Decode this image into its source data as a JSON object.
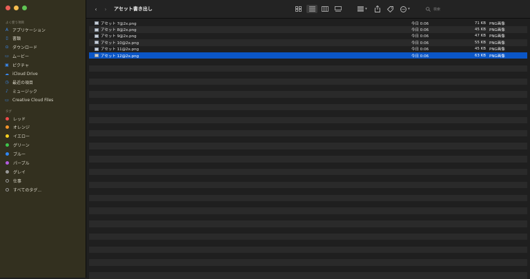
{
  "window": {
    "title": "アセット書き出し",
    "traffic_colors": [
      "#ec5f57",
      "#f5bd4f",
      "#60c554"
    ]
  },
  "toolbar": {
    "back_icon": "chevron-left-icon",
    "forward_icon": "chevron-right-icon",
    "view_icons": [
      "grid-view-icon",
      "list-view-icon",
      "column-view-icon",
      "gallery-view-icon"
    ],
    "search_placeholder": "検索"
  },
  "sidebar": {
    "favorites_label": "よく使う項目",
    "favorites": [
      {
        "label": "アプリケーション",
        "icon": "A"
      },
      {
        "label": "書類",
        "icon": "▯"
      },
      {
        "label": "ダウンロード",
        "icon": "⊙"
      },
      {
        "label": "ムービー",
        "icon": "▭"
      },
      {
        "label": "ピクチャ",
        "icon": "▣"
      },
      {
        "label": "iCloud Drive",
        "icon": "☁"
      },
      {
        "label": "最近の項目",
        "icon": "◷"
      },
      {
        "label": "ミュージック",
        "icon": "♪"
      },
      {
        "label": "Creative Cloud Files",
        "icon": "▭"
      }
    ],
    "tags_label": "タグ",
    "tags": [
      {
        "label": "レッド",
        "color": "#ef4b4b"
      },
      {
        "label": "オレンジ",
        "color": "#f5952a"
      },
      {
        "label": "イエロー",
        "color": "#f5d020"
      },
      {
        "label": "グリーン",
        "color": "#3ec44b"
      },
      {
        "label": "ブルー",
        "color": "#2f86f2"
      },
      {
        "label": "パープル",
        "color": "#b35cdf"
      },
      {
        "label": "グレイ",
        "color": "#9a9a9a"
      },
      {
        "label": "仕事",
        "color": "outline"
      },
      {
        "label": "すべてのタグ...",
        "color": "outline"
      }
    ]
  },
  "files": [
    {
      "name": "アセット 7@2x.png",
      "date": "今日 0:06",
      "size": "71 KB",
      "kind": "PNG画像",
      "selected": false
    },
    {
      "name": "アセット 8@2x.png",
      "date": "今日 0:06",
      "size": "45 KB",
      "kind": "PNG画像",
      "selected": false
    },
    {
      "name": "アセット 9@2x.png",
      "date": "今日 0:06",
      "size": "47 KB",
      "kind": "PNG画像",
      "selected": false
    },
    {
      "name": "アセット 10@2x.png",
      "date": "今日 0:06",
      "size": "55 KB",
      "kind": "PNG画像",
      "selected": false
    },
    {
      "name": "アセット 11@2x.png",
      "date": "今日 0:06",
      "size": "45 KB",
      "kind": "PNG画像",
      "selected": false
    },
    {
      "name": "アセット 12@2x.png",
      "date": "今日 0:06",
      "size": "63 KB",
      "kind": "PNG画像",
      "selected": true
    }
  ]
}
